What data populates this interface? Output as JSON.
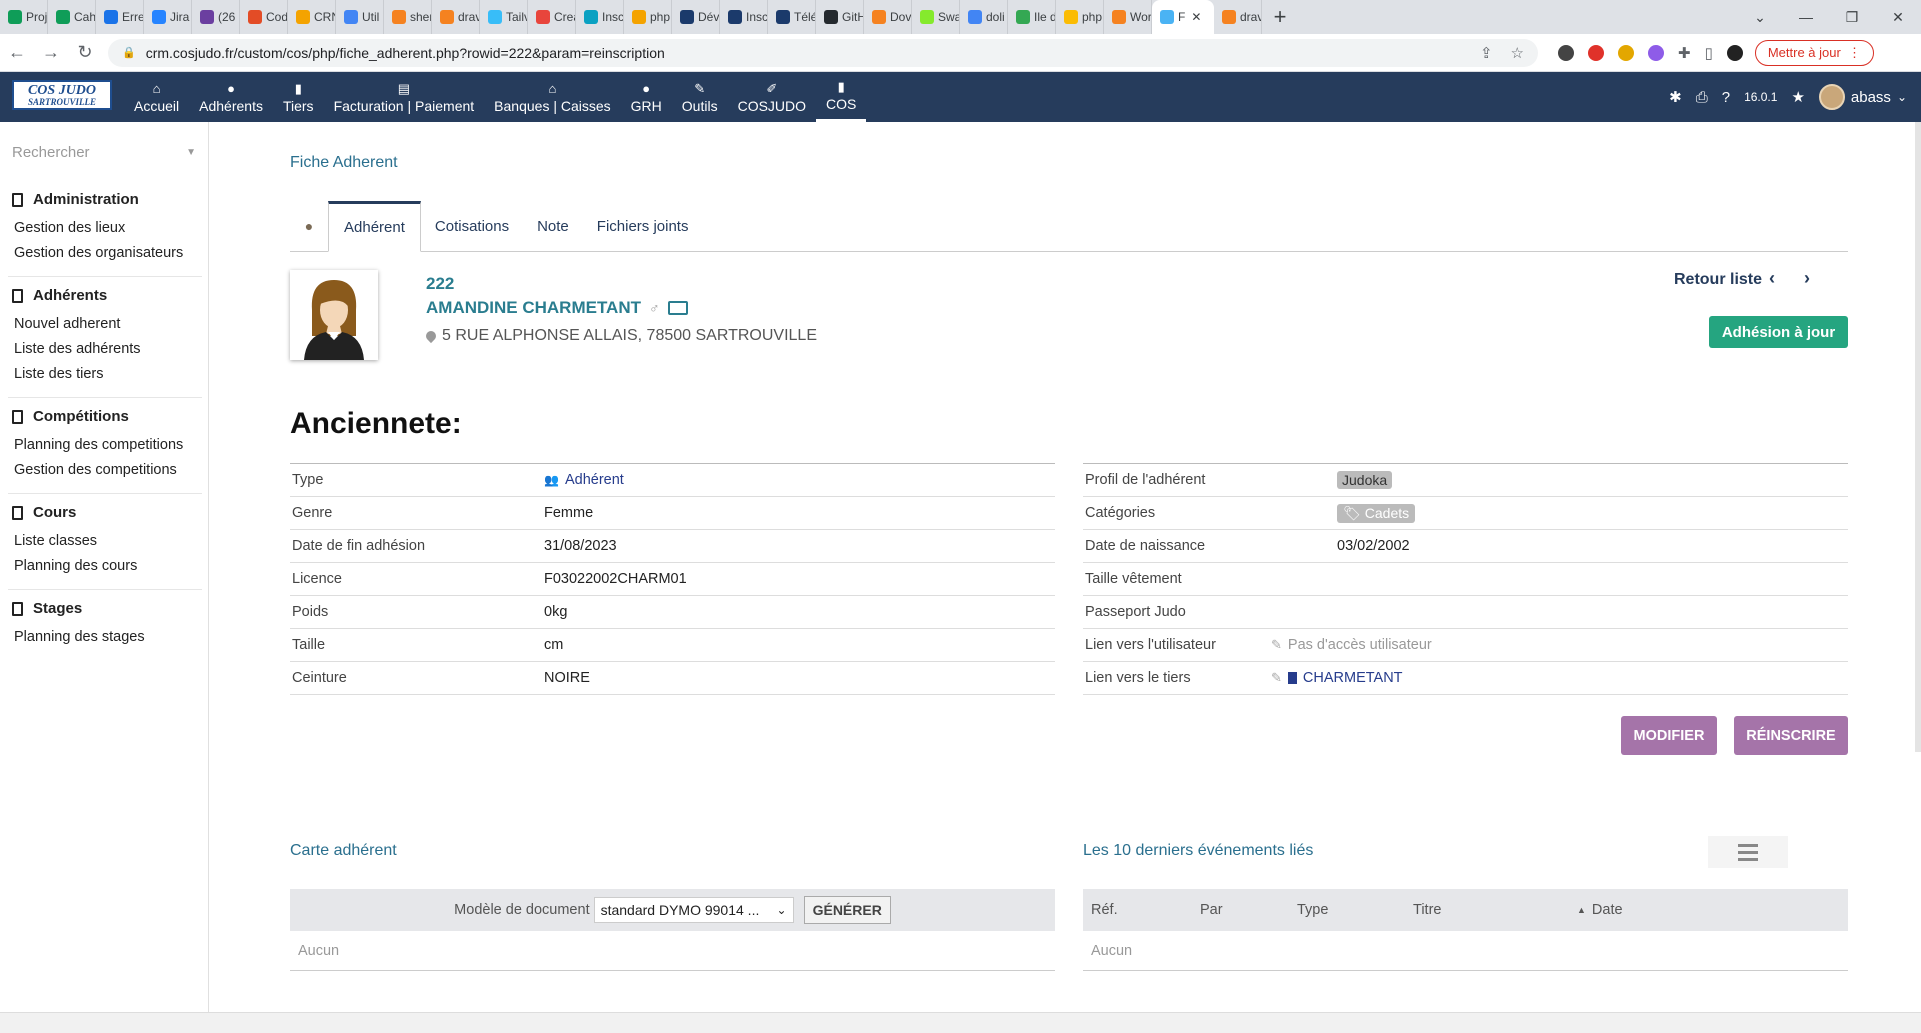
{
  "browser": {
    "tabs": [
      {
        "label": "Proj",
        "color": "#0f9d58"
      },
      {
        "label": "Cahi",
        "color": "#0f9d58"
      },
      {
        "label": "Erre",
        "color": "#1a73e8"
      },
      {
        "label": "Jira",
        "color": "#2684ff"
      },
      {
        "label": "(26",
        "color": "#6b3fa0"
      },
      {
        "label": "Cod",
        "color": "#e34c26"
      },
      {
        "label": "CRN",
        "color": "#f4a300"
      },
      {
        "label": "Util",
        "color": "#4285f4"
      },
      {
        "label": "sher",
        "color": "#f58220"
      },
      {
        "label": "drav",
        "color": "#f58220"
      },
      {
        "label": "Tailv",
        "color": "#38bdf8"
      },
      {
        "label": "Crea",
        "color": "#e8453c"
      },
      {
        "label": "Insc",
        "color": "#0aa1c2"
      },
      {
        "label": "php",
        "color": "#f4a300"
      },
      {
        "label": "Dév",
        "color": "#1b3a6b"
      },
      {
        "label": "Insc",
        "color": "#1b3a6b"
      },
      {
        "label": "Télé",
        "color": "#1b3a6b"
      },
      {
        "label": "GitH",
        "color": "#24292e"
      },
      {
        "label": "Dov",
        "color": "#f58220"
      },
      {
        "label": "Swa",
        "color": "#85ea2d"
      },
      {
        "label": "doli",
        "color": "#4285f4"
      },
      {
        "label": "Ile d",
        "color": "#34a853"
      },
      {
        "label": "php",
        "color": "#fbbc04"
      },
      {
        "label": "Wor",
        "color": "#f58220"
      },
      {
        "label": "F",
        "color": "#4ab3f4",
        "active": true
      },
      {
        "label": "drav",
        "color": "#f58220"
      }
    ],
    "url": "crm.cosjudo.fr/custom/cos/php/fiche_adherent.php?rowid=222&param=reinscription",
    "update_label": "Mettre à jour"
  },
  "app": {
    "logo_top": "COS JUDO",
    "logo_bottom": "SARTROUVILLE",
    "menu": [
      {
        "label": "Accueil",
        "icon": "⌂"
      },
      {
        "label": "Adhérents",
        "icon": "●"
      },
      {
        "label": "Tiers",
        "icon": "▮"
      },
      {
        "label": "Facturation | Paiement",
        "icon": "▤"
      },
      {
        "label": "Banques | Caisses",
        "icon": "⌂"
      },
      {
        "label": "GRH",
        "icon": "●"
      },
      {
        "label": "Outils",
        "icon": "✎"
      },
      {
        "label": "COSJUDO",
        "icon": "✐"
      },
      {
        "label": "COS",
        "icon": "▮",
        "active": true
      }
    ],
    "version": "16.0.1",
    "username": "abass"
  },
  "sidebar": {
    "search_placeholder": "Rechercher",
    "groups": [
      {
        "title": "Administration",
        "items": [
          "Gestion des lieux",
          "Gestion des organisateurs"
        ]
      },
      {
        "title": "Adhérents",
        "items": [
          "Nouvel adherent",
          "Liste des adhérents",
          "Liste des tiers"
        ]
      },
      {
        "title": "Compétitions",
        "items": [
          "Planning des competitions",
          "Gestion des competitions"
        ]
      },
      {
        "title": "Cours",
        "items": [
          "Liste classes",
          "Planning des cours"
        ]
      },
      {
        "title": "Stages",
        "items": [
          "Planning des stages"
        ]
      }
    ]
  },
  "page": {
    "breadcrumb": "Fiche Adherent",
    "tabs": [
      "Adhérent",
      "Cotisations",
      "Note",
      "Fichiers joints"
    ],
    "active_tab": "Adhérent",
    "ref": "222",
    "name": "AMANDINE CHARMETANT",
    "gender_symbol": "♂",
    "address": "5 RUE ALPHONSE ALLAIS, 78500 SARTROUVILLE",
    "back_list": "Retour liste",
    "status_button": "Adhésion à jour",
    "section_title": "Anciennete:",
    "left_fields": [
      {
        "label": "Type",
        "value": "Adhérent"
      },
      {
        "label": "Genre",
        "value": "Femme"
      },
      {
        "label": "Date de fin adhésion",
        "value": "31/08/2023"
      },
      {
        "label": "Licence",
        "value": "F03022002CHARM01"
      },
      {
        "label": "Poids",
        "value": "0kg"
      },
      {
        "label": "Taille",
        "value": "cm"
      },
      {
        "label": "Ceinture",
        "value": "NOIRE"
      }
    ],
    "right_fields": [
      {
        "label": "Profil de l'adhérent",
        "value": "Judoka"
      },
      {
        "label": "Catégories",
        "value": "Cadets"
      },
      {
        "label": "Date de naissance",
        "value": "03/02/2002"
      },
      {
        "label": "Taille vêtement",
        "value": ""
      },
      {
        "label": "Passeport Judo",
        "value": ""
      },
      {
        "label": "Lien vers l'utilisateur",
        "value": "Pas d'accès utilisateur"
      },
      {
        "label": "Lien vers le tiers",
        "value": "CHARMETANT"
      }
    ],
    "modify_button": "MODIFIER",
    "reinscribe_button": "RÉINSCRIRE",
    "card_section": {
      "title": "Carte adhérent",
      "model_label": "Modèle de document",
      "model_value": "standard DYMO 99014 ...",
      "generate_button": "GÉNÉRER",
      "empty": "Aucun"
    },
    "events_section": {
      "title": "Les 10 derniers événements liés",
      "columns": [
        "Réf.",
        "Par",
        "Type",
        "Titre",
        "Date"
      ],
      "empty": "Aucun"
    }
  }
}
